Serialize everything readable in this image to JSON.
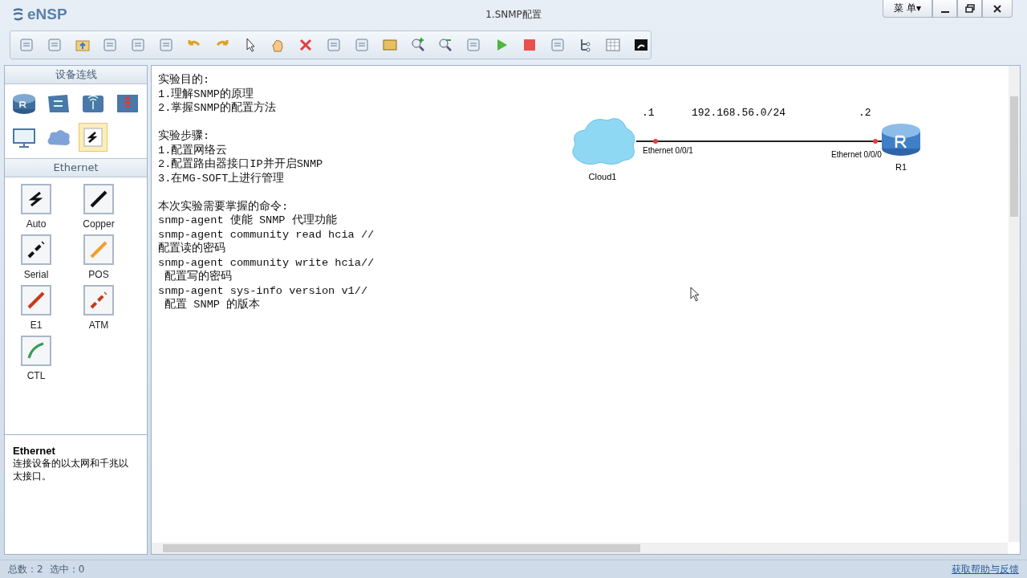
{
  "window": {
    "logo": "eNSP",
    "title": "1.SNMP配置",
    "menu_button": "菜 单▾"
  },
  "device_panel": {
    "title": "设备连线",
    "devices": [
      {
        "kind": "router",
        "selected": false
      },
      {
        "kind": "switch",
        "selected": false
      },
      {
        "kind": "wireless",
        "selected": false
      },
      {
        "kind": "firewall",
        "selected": false
      },
      {
        "kind": "pc",
        "selected": false
      },
      {
        "kind": "cloud",
        "selected": false
      },
      {
        "kind": "cable",
        "selected": true
      }
    ]
  },
  "cable_panel": {
    "title": "Ethernet",
    "cables": [
      {
        "label": "Auto",
        "kind": "auto"
      },
      {
        "label": "Copper",
        "kind": "copper"
      },
      {
        "label": "Serial",
        "kind": "serial"
      },
      {
        "label": "POS",
        "kind": "pos"
      },
      {
        "label": "E1",
        "kind": "e1"
      },
      {
        "label": "ATM",
        "kind": "atm"
      },
      {
        "label": "CTL",
        "kind": "ctl"
      }
    ]
  },
  "info_box": {
    "title": "Ethernet",
    "text": "连接设备的以太网和千兆以太接口。"
  },
  "notes": [
    [
      "实验目的:",
      "1.理解SNMP的原理",
      "2.掌握SNMP的配置方法"
    ],
    [
      "实验步骤:",
      "1.配置网络云",
      "2.配置路由器接口IP并开启SNMP",
      "3.在MG-SOFT上进行管理"
    ],
    [
      "本次实验需要掌握的命令:",
      "snmp-agent 使能 SNMP 代理功能",
      "snmp-agent community read hcia //",
      "配置读的密码",
      "snmp-agent community write hcia//",
      " 配置写的密码",
      "snmp-agent sys-info version v1//",
      " 配置 SNMP 的版本"
    ]
  ],
  "topology": {
    "nodes": [
      {
        "kind": "cloud",
        "label": "Cloud1"
      },
      {
        "kind": "router",
        "label": "R1"
      }
    ],
    "link": {
      "left_port": "Ethernet 0/0/1",
      "right_port": "Ethernet 0/0/0",
      "left_address": ".1",
      "network": "192.168.56.0/24",
      "right_address": ".2"
    }
  },
  "status_bar": {
    "total": "总数：2",
    "selected": "选中：0",
    "help_link": "获取帮助与反馈"
  }
}
